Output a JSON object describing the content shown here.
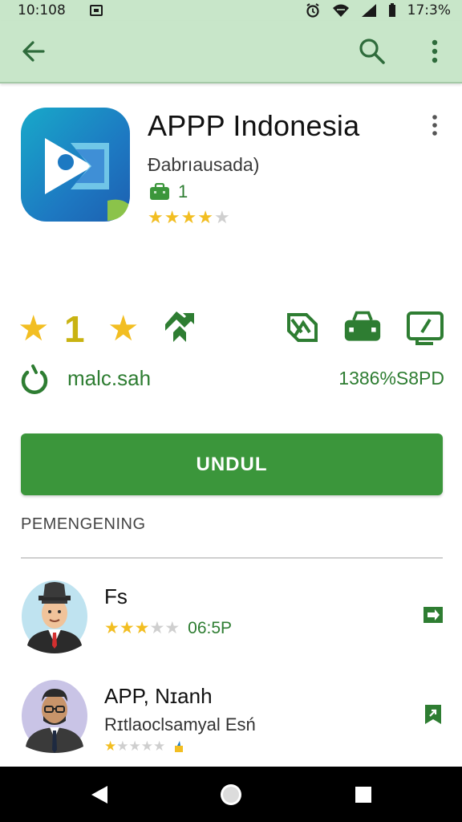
{
  "status_bar": {
    "time": "10:108",
    "battery": "17:3%"
  },
  "toolbar": {
    "back_icon": "arrow-left-icon",
    "search_icon": "search-icon",
    "more_icon": "more-vert-icon"
  },
  "app": {
    "title": "APPP Indonesia",
    "developer": "Ɖabrıausada)",
    "badge_count": "1",
    "rating_stars": 4
  },
  "stats": {
    "rating": "1"
  },
  "installs": {
    "label": "malc.sah",
    "size": "1386%S8PD"
  },
  "install_button": {
    "label": "UNDUL"
  },
  "section": {
    "heading": "PEMENGENING"
  },
  "reviews": [
    {
      "name": "Fs",
      "stars": 3,
      "date": "06:5P"
    },
    {
      "name": "APP, Nɪanh",
      "subtitle": "Rɪtlaoclsamyal Esń",
      "stars": 1
    }
  ],
  "colors": {
    "accent": "#3b963b",
    "toolbar": "#c8e6c9",
    "star": "#f2be22",
    "green_text": "#2e7d32"
  }
}
